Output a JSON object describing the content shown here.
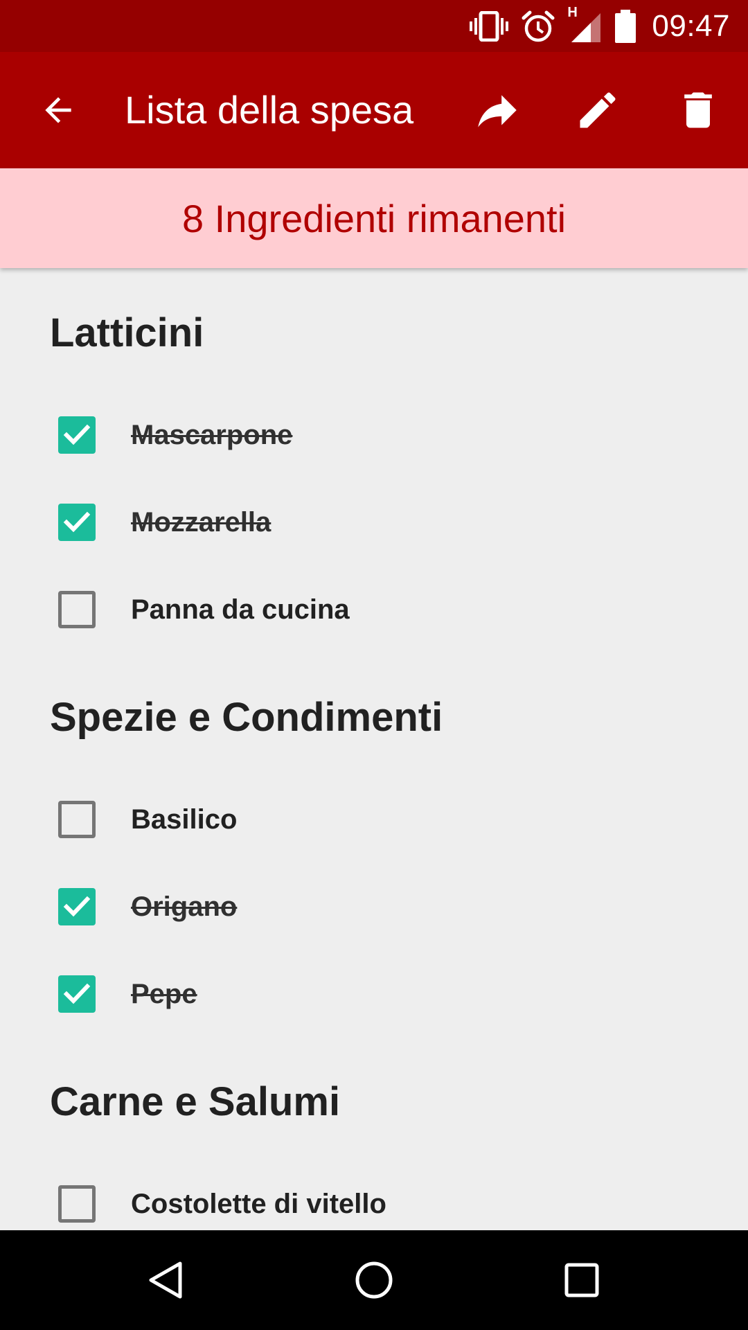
{
  "status_bar": {
    "time": "09:47",
    "network_label": "H",
    "icons": [
      "vibrate-icon",
      "alarm-icon",
      "signal-icon",
      "battery-icon"
    ]
  },
  "app_bar": {
    "title": "Lista della spesa",
    "back_icon": "arrow-back-icon",
    "actions": [
      "share-icon",
      "edit-icon",
      "delete-icon"
    ],
    "background": "#a90000"
  },
  "banner": {
    "text": "8 Ingredienti rimanenti",
    "background": "#ffcdd2",
    "color": "#b00000"
  },
  "sections": [
    {
      "title": "Latticini",
      "items": [
        {
          "label": "Mascarpone",
          "checked": true
        },
        {
          "label": "Mozzarella",
          "checked": true
        },
        {
          "label": "Panna da cucina",
          "checked": false
        }
      ]
    },
    {
      "title": "Spezie e Condimenti",
      "items": [
        {
          "label": "Basilico",
          "checked": false
        },
        {
          "label": "Origano",
          "checked": true
        },
        {
          "label": "Pepe",
          "checked": true
        }
      ]
    },
    {
      "title": "Carne e Salumi",
      "items": [
        {
          "label": "Costolette di vitello",
          "checked": false
        }
      ]
    }
  ],
  "checkbox_color": "#1bbc9b",
  "nav_bar": {
    "buttons": [
      "nav-back-icon",
      "nav-home-icon",
      "nav-recents-icon"
    ]
  }
}
